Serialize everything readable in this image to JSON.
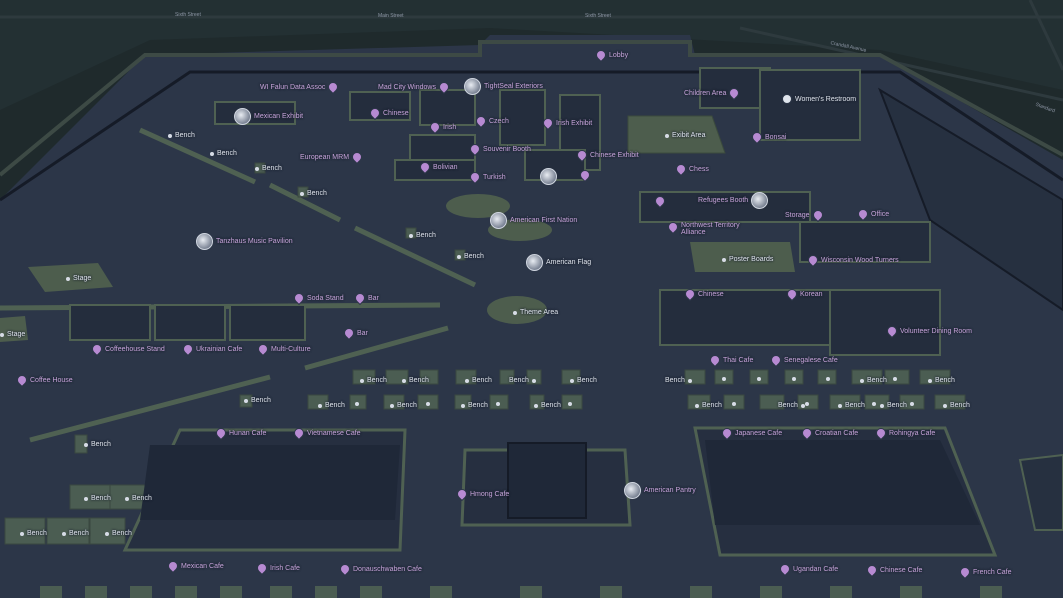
{
  "streets": [
    "Sixth Street",
    "Main Street",
    "Sixth Street",
    "Crandall Avenue",
    "Standard"
  ],
  "labels": {
    "lobby": "Lobby",
    "wi_falun": "WI Falun Data Assoc",
    "mad_city": "Mad City Windows",
    "tightseal": "TightSeal Exteriors",
    "mexican_exhibit": "Mexican Exhibit",
    "chinese_1": "Chinese",
    "czech": "Czech",
    "irish_1": "Irish",
    "irish_exhibit": "Irish Exhibit",
    "souvenir": "Souvenir Booth",
    "chinese_exhibit": "Chinese Exhibit",
    "european_mrm": "European MRM",
    "bolivian": "Bolivian",
    "turkish": "Turkish",
    "children_area": "Children Area",
    "womens_restroom": "Women's Restroom",
    "bonsai": "Bonsai",
    "exibit_area": "Exibit Area",
    "chess": "Chess",
    "refugees_booth": "Refugees Booth",
    "storage": "Storage",
    "office": "Office",
    "american_first_nation": "American First Nation",
    "northwest_territory": "Northwest Territory Alliance",
    "tanzhaus": "Tanzhaus Music Pavilion",
    "american_flag": "American Flag",
    "poster_boards": "Poster Boards",
    "wisconsin_wood": "Wisconsin Wood Turners",
    "stage_1": "Stage",
    "stage_2": "Stage",
    "soda_stand": "Soda Stand",
    "bar_1": "Bar",
    "bar_2": "Bar",
    "theme_area": "Theme Area",
    "chinese_2": "Chinese",
    "korean": "Korean",
    "volunteer_dining": "Volunteer Dining Room",
    "coffeehouse_stand": "Coffeehouse Stand",
    "ukrainian_cafe": "Ukrainian Cafe",
    "multi_culture": "Multi-Culture",
    "thai_cafe": "Thai Cafe",
    "senegalese_cafe": "Senegalese Cafe",
    "coffee_house": "Coffee House",
    "hunan_cafe": "Hunan Cafe",
    "vietnamese_cafe": "Vietnamese Cafe",
    "japanese_cafe": "Japanese Cafe",
    "croatian_cafe": "Croatian Cafe",
    "rohingya_cafe": "Rohingya Cafe",
    "hmong_cafe": "Hmong Cafe",
    "american_pantry": "American Pantry",
    "mexican_cafe": "Mexican Cafe",
    "irish_cafe": "Irish Cafe",
    "donauschwaben_cafe": "Donauschwaben Cafe",
    "ugandan_cafe": "Ugandan Cafe",
    "chinese_cafe": "Chinese Cafe",
    "french_cafe": "French Cafe",
    "bench": "Bench"
  },
  "colors": {
    "floor": "#2c3648",
    "grass": "#1f2a2c",
    "wall_top": "#4a5a4f",
    "wall_side": "#151b27",
    "poi": "#c6a3d9",
    "bench_block": "#4b5d52"
  }
}
